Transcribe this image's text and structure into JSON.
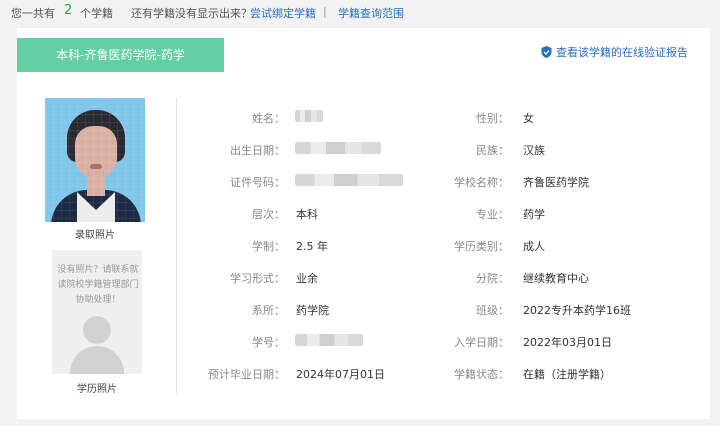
{
  "topbar": {
    "prefix": "您一共有",
    "count": "2",
    "suffix": "个学籍",
    "question": "还有学籍没有显示出来？",
    "bind_link": "尝试绑定学籍",
    "separator": "|",
    "scope_link": "学籍查询范围"
  },
  "card": {
    "tag": "本科-齐鲁医药学院-药学",
    "verify_link": "查看该学籍的在线验证报告",
    "admission_photo_caption": "录取照片",
    "no_photo_text": "没有照片？请联系就读院校学籍管理部门协助处理！",
    "degree_photo_caption": "学历照片",
    "left_fields": [
      {
        "label": "姓名：",
        "value": ""
      },
      {
        "label": "出生日期：",
        "value": ""
      },
      {
        "label": "证件号码：",
        "value": ""
      },
      {
        "label": "层次：",
        "value": "本科"
      },
      {
        "label": "学制：",
        "value": "2.5 年"
      },
      {
        "label": "学习形式：",
        "value": "业余"
      },
      {
        "label": "系所：",
        "value": "药学院"
      },
      {
        "label": "学号：",
        "value": ""
      },
      {
        "label": "预计毕业日期：",
        "value": "2024年07月01日"
      }
    ],
    "right_fields": [
      {
        "label": "性别：",
        "value": "女"
      },
      {
        "label": "民族：",
        "value": "汉族"
      },
      {
        "label": "学校名称：",
        "value": "齐鲁医药学院"
      },
      {
        "label": "专业：",
        "value": "药学"
      },
      {
        "label": "学历类别：",
        "value": "成人"
      },
      {
        "label": "分院：",
        "value": "继续教育中心"
      },
      {
        "label": "班级：",
        "value": "2022专升本药学16班"
      },
      {
        "label": "入学日期：",
        "value": "2022年03月01日"
      },
      {
        "label": "学籍状态：",
        "value": "在籍（注册学籍）"
      }
    ]
  },
  "colors": {
    "tag_bg": "#64cfa4",
    "link": "#2a6ec4",
    "count": "#2ea24a"
  }
}
